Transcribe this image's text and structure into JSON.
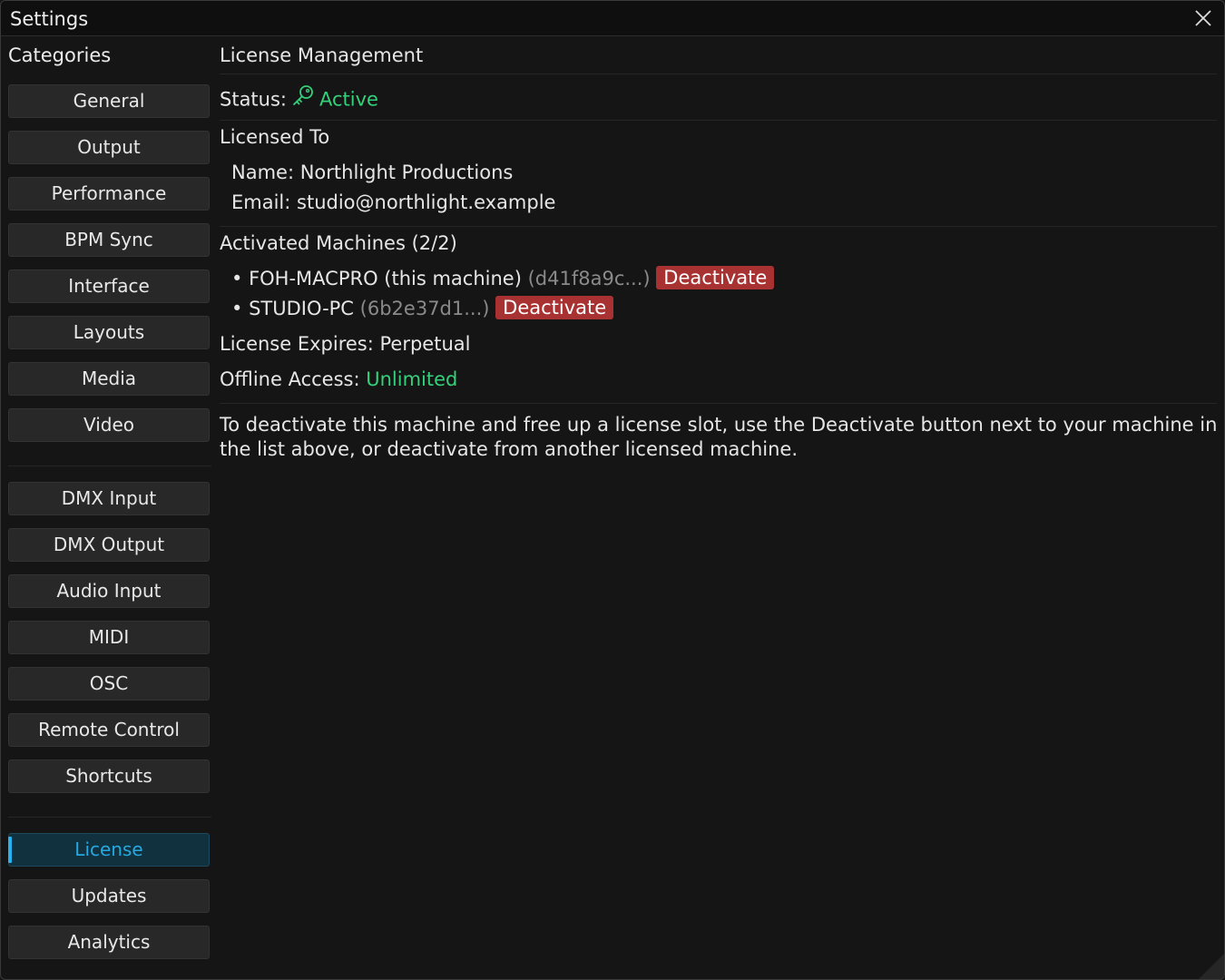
{
  "window": {
    "title": "Settings"
  },
  "sidebar": {
    "heading": "Categories",
    "groups": [
      [
        "General",
        "Output",
        "Performance",
        "BPM Sync",
        "Interface",
        "Layouts",
        "Media",
        "Video"
      ],
      [
        "DMX Input",
        "DMX Output",
        "Audio Input",
        "MIDI",
        "OSC",
        "Remote Control",
        "Shortcuts"
      ],
      [
        "License",
        "Updates",
        "Analytics"
      ]
    ],
    "active": "License"
  },
  "license": {
    "heading": "License Management",
    "status_label": "Status:",
    "status_value": "Active",
    "licensed_to_heading": "Licensed To",
    "name_line": "Name: Northlight Productions",
    "email_line": "Email: studio@northlight.example",
    "machines_heading": "Activated Machines (2/2)",
    "machines": [
      {
        "name": "FOH-MACPRO (this machine)",
        "id": "(d41f8a9c...)",
        "action": "Deactivate"
      },
      {
        "name": "STUDIO-PC",
        "id": "(6b2e37d1...)",
        "action": "Deactivate"
      }
    ],
    "expires_line": "License Expires: Perpetual",
    "offline_label": "Offline Access:",
    "offline_value": "Unlimited",
    "info_text": "To deactivate this machine and free up a license slot, use the Deactivate button next to your machine in the list above, or deactivate from another licensed machine."
  },
  "colors": {
    "accent": "#27b1ee",
    "active_green": "#34d17a",
    "danger": "#a83232"
  },
  "icons": {
    "status": "key-icon",
    "close": "close-icon"
  }
}
